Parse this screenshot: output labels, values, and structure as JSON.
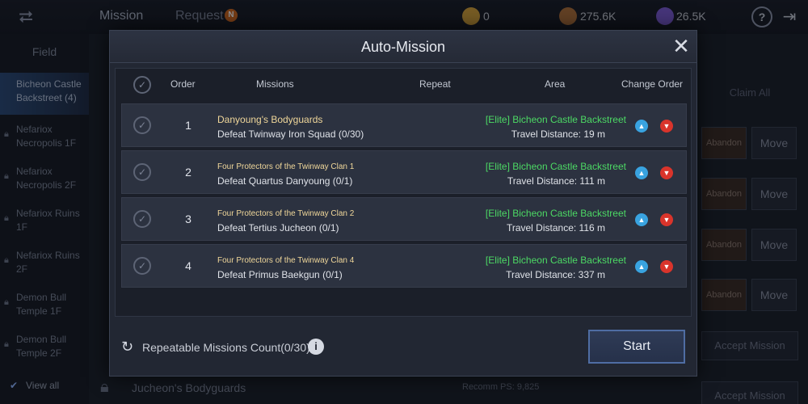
{
  "topbar": {
    "tabs": [
      {
        "label": "Mission",
        "active": true
      },
      {
        "label": "Request",
        "active": false
      }
    ],
    "request_badge": "N",
    "currencies": [
      {
        "icon": "gold-coin-icon",
        "value": "0",
        "color": "#d6a23a"
      },
      {
        "icon": "copper-coin-icon",
        "value": "275.6K",
        "color": "#b0703a"
      },
      {
        "icon": "purple-crystal-icon",
        "value": "26.5K",
        "color": "#7c5bd6"
      }
    ],
    "help_label": "?"
  },
  "sidebar": {
    "header": "Field",
    "items": [
      {
        "label": "Bicheon Castle Backstreet (4)",
        "active": true,
        "locked": false
      },
      {
        "label": "Nefariox Necropolis 1F",
        "active": false,
        "locked": true
      },
      {
        "label": "Nefariox Necropolis 2F",
        "active": false,
        "locked": true
      },
      {
        "label": "Nefariox Ruins 1F",
        "active": false,
        "locked": true
      },
      {
        "label": "Nefariox Ruins 2F",
        "active": false,
        "locked": true
      },
      {
        "label": "Demon Bull Temple 1F",
        "active": false,
        "locked": true
      },
      {
        "label": "Demon Bull Temple 2F",
        "active": false,
        "locked": true
      }
    ],
    "view_all": "View all"
  },
  "background": {
    "claim_all": "Claim All",
    "abandon": "Abandon",
    "move": "Move",
    "accept_mission": "Accept Mission",
    "row_title": "Jucheon's Bodyguards",
    "recomm": "Recomm PS: 9,825"
  },
  "modal": {
    "title": "Auto-Mission",
    "headers": {
      "order": "Order",
      "missions": "Missions",
      "repeat": "Repeat",
      "area": "Area",
      "change_order": "Change Order"
    },
    "missions": [
      {
        "order": "1",
        "title": "Danyoung's Bodyguards",
        "desc": "Defeat Twinway Iron Squad (0/30)",
        "area": "[Elite] Bicheon Castle Backstreet",
        "distance": "Travel Distance: 19 m"
      },
      {
        "order": "2",
        "title": "Four Protectors of the Twinway Clan 1",
        "desc": "Defeat Quartus Danyoung (0/1)",
        "area": "[Elite] Bicheon Castle Backstreet",
        "distance": "Travel Distance: 111 m"
      },
      {
        "order": "3",
        "title": "Four Protectors of the Twinway Clan 2",
        "desc": "Defeat Tertius Jucheon (0/1)",
        "area": "[Elite] Bicheon Castle Backstreet",
        "distance": "Travel Distance: 116 m"
      },
      {
        "order": "4",
        "title": "Four Protectors of the Twinway Clan 4",
        "desc": "Defeat Primus Baekgun (0/1)",
        "area": "[Elite] Bicheon Castle Backstreet",
        "distance": "Travel Distance: 337 m"
      }
    ],
    "repeat_count": "Repeatable Missions Count(0/30)",
    "info": "i",
    "start": "Start"
  }
}
